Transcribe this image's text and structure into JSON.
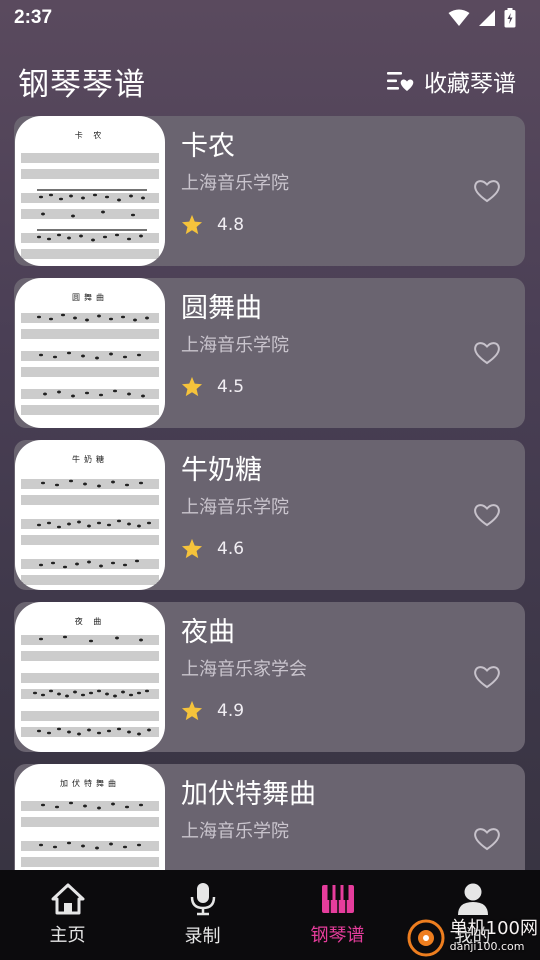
{
  "status_bar": {
    "time": "2:37"
  },
  "header": {
    "title": "钢琴琴谱",
    "favorites_label": "收藏琴谱"
  },
  "songs": [
    {
      "title": "卡农",
      "source": "上海音乐学院",
      "rating": "4.8",
      "sheet_title": "卡 农"
    },
    {
      "title": "圆舞曲",
      "source": "上海音乐学院",
      "rating": "4.5",
      "sheet_title": "圆舞曲"
    },
    {
      "title": "牛奶糖",
      "source": "上海音乐学院",
      "rating": "4.6",
      "sheet_title": "牛奶糖"
    },
    {
      "title": "夜曲",
      "source": "上海音乐家学会",
      "rating": "4.9",
      "sheet_title": "夜 曲"
    },
    {
      "title": "加伏特舞曲",
      "source": "上海音乐学院",
      "rating": "",
      "sheet_title": "加伏特舞曲"
    }
  ],
  "bottom_nav": {
    "items": [
      {
        "label": "主页",
        "icon": "home-icon",
        "active": false
      },
      {
        "label": "录制",
        "icon": "microphone-icon",
        "active": false
      },
      {
        "label": "钢琴谱",
        "icon": "piano-icon",
        "active": true
      },
      {
        "label": "我的",
        "icon": "user-icon",
        "active": false
      }
    ]
  },
  "watermark": {
    "main": "单机100网",
    "sub": "danji100.com"
  },
  "colors": {
    "accent": "#e63d9c",
    "card_bg": "#6a6470",
    "star": "#f5c33b"
  }
}
